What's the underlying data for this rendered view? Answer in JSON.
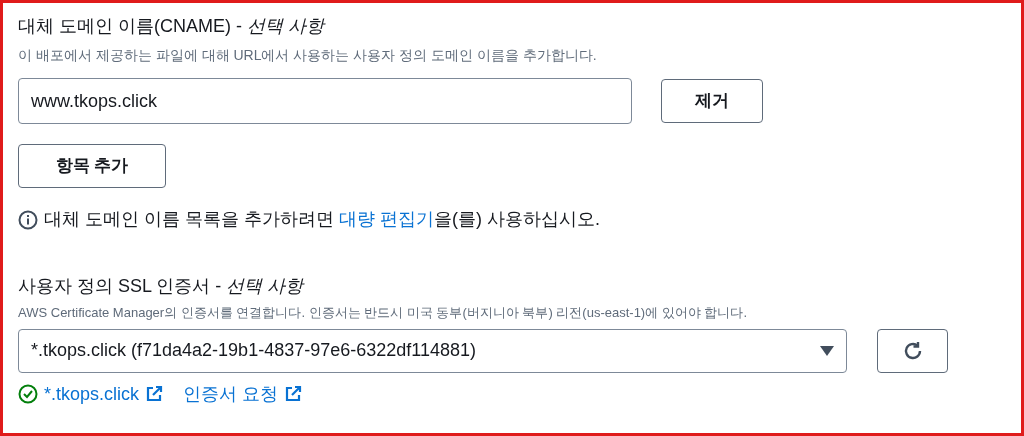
{
  "cname": {
    "label": "대체 도메인 이름(CNAME) - *선택 사항*",
    "description": "이 배포에서 제공하는 파일에 대해 URL에서 사용하는 사용자 정의 도메인 이름을 추가합니다.",
    "entries": [
      {
        "value": "www.tkops.click",
        "remove": "제거"
      }
    ],
    "add_button": "항목 추가",
    "info": {
      "before": "대체 도메인 이름 목록을 추가하려면 ",
      "link": "대량 편집기",
      "after": "을(를) 사용하십시오."
    }
  },
  "ssl": {
    "label": "사용자 정의 SSL 인증서 - *선택 사항*",
    "description": "AWS Certificate Manager의 인증서를 연결합니다. 인증서는 반드시 미국 동부(버지니아 북부) 리전(us-east-1)에 있어야 합니다.",
    "selected": "*.tkops.click (f71da4a2-19b1-4837-97e6-6322df114881)",
    "links": [
      {
        "label": "*.tkops.click",
        "kind": "validated"
      },
      {
        "label": "인증서 요청",
        "kind": "plain"
      }
    ]
  }
}
